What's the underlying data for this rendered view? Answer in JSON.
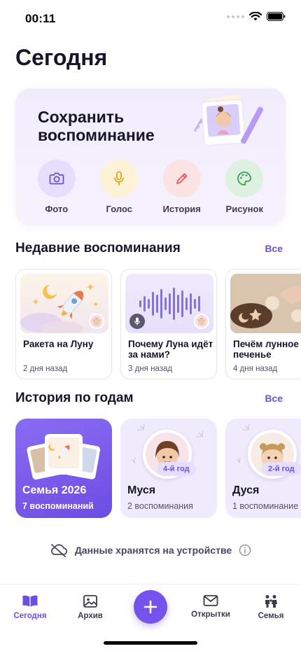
{
  "status_bar": {
    "time": "00:11"
  },
  "page": {
    "title": "Сегодня"
  },
  "capture": {
    "title": "Сохранить воспоминание",
    "actions": [
      {
        "label": "Фото",
        "icon": "camera-icon",
        "bg": "#e6dffb",
        "color": "#6a4fe0"
      },
      {
        "label": "Голос",
        "icon": "microphone-icon",
        "bg": "#fdf1d6",
        "color": "#e0a825"
      },
      {
        "label": "История",
        "icon": "pencil-icon",
        "bg": "#fbe3e3",
        "color": "#e15a5a"
      },
      {
        "label": "Рисунок",
        "icon": "palette-icon",
        "bg": "#def1e1",
        "color": "#3a9c56"
      }
    ]
  },
  "recent": {
    "title": "Недавние воспоминания",
    "link": "Все",
    "items": [
      {
        "title": "Ракета на Луну",
        "date": "2 дня назад"
      },
      {
        "title": "Почему Луна идёт за нами?",
        "date": "3 дня назад"
      },
      {
        "title": "Печём лунное печенье",
        "date": "4 дня назад"
      }
    ]
  },
  "years": {
    "title": "История по годам",
    "link": "Все",
    "items": [
      {
        "name": "Семья 2026",
        "count": "7 воспоминаний"
      },
      {
        "name": "Муся",
        "count": "2 воспоминания",
        "badge": "4-й год"
      },
      {
        "name": "Дуся",
        "count": "1 воспоминание",
        "badge": "2-й год"
      }
    ]
  },
  "storage": {
    "text": "Данные хранятся на устройстве"
  },
  "tabs": [
    {
      "label": "Сегодня",
      "icon": "book-open-icon"
    },
    {
      "label": "Архив",
      "icon": "gallery-icon"
    },
    {
      "label": "Открытки",
      "icon": "envelope-icon"
    },
    {
      "label": "Семья",
      "icon": "family-icon"
    }
  ],
  "colors": {
    "accent": "#6a4fe0",
    "fab": "#7652ec",
    "family_card": "#7a5cee"
  }
}
